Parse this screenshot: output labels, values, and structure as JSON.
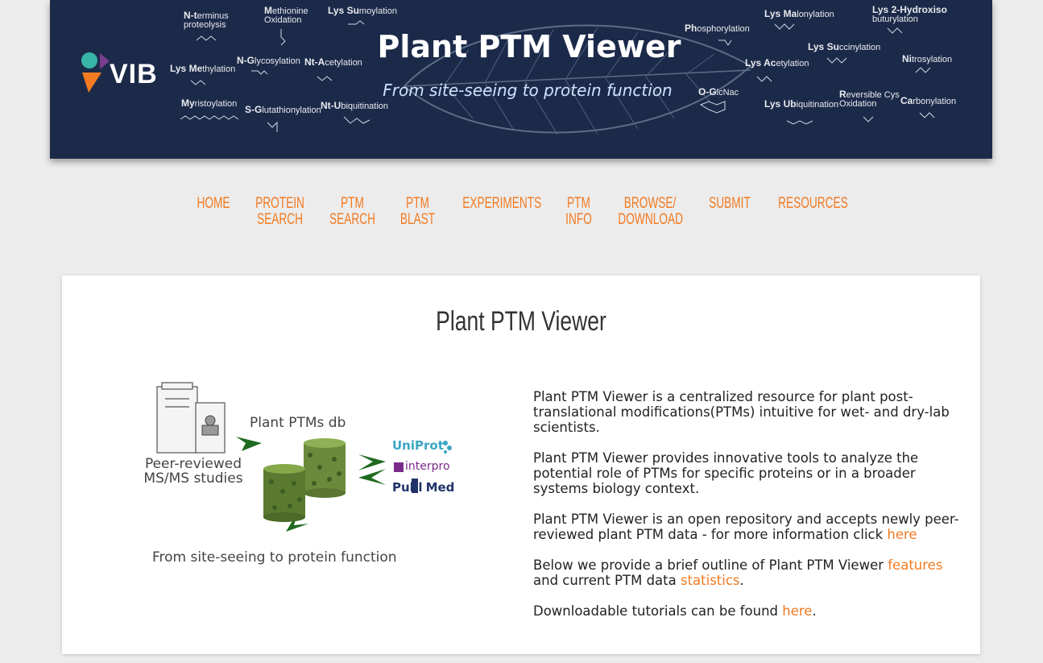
{
  "banner": {
    "title": "Plant PTM Viewer",
    "subtitle": "From site-seeing to protein function",
    "logo_text": "VIB",
    "ptm_labels": [
      {
        "bold": "N-t",
        "rest": "erminus",
        "line2": "proteolysis"
      },
      {
        "bold": "M",
        "rest": "ethionine",
        "line2": "Oxidation"
      },
      {
        "bold": "Lys Su",
        "rest": "moylation",
        "line2": ""
      },
      {
        "bold": "Lys Me",
        "rest": "thylation",
        "line2": ""
      },
      {
        "bold": "N-G",
        "rest": "lycosylation",
        "line2": ""
      },
      {
        "bold": "Nt-A",
        "rest": "cetylation",
        "line2": ""
      },
      {
        "bold": "My",
        "rest": "ristoylation",
        "line2": ""
      },
      {
        "bold": "S-G",
        "rest": "lutathionylation",
        "line2": ""
      },
      {
        "bold": "Nt-U",
        "rest": "biquitination",
        "line2": ""
      },
      {
        "bold": "Lys Ma",
        "rest": "lonylation",
        "line2": ""
      },
      {
        "bold": "Lys 2-Hydroxiso",
        "rest": "",
        "line2": "buturylation"
      },
      {
        "bold": "Ph",
        "rest": "osphorylation",
        "line2": ""
      },
      {
        "bold": "Lys Su",
        "rest": "ccinylation",
        "line2": ""
      },
      {
        "bold": "Lys Ac",
        "rest": "etylation",
        "line2": ""
      },
      {
        "bold": "Ni",
        "rest": "trosylation",
        "line2": ""
      },
      {
        "bold": "O-G",
        "rest": "lcNac",
        "line2": ""
      },
      {
        "bold": "Lys Ub",
        "rest": "iquitination",
        "line2": ""
      },
      {
        "bold": "R",
        "rest": "eversible Cys",
        "line2": "Oxidation"
      },
      {
        "bold": "Ca",
        "rest": "rbonylation",
        "line2": ""
      }
    ]
  },
  "nav": {
    "items": [
      {
        "line1": "HOME",
        "line2": ""
      },
      {
        "line1": "PROTEIN",
        "line2": "SEARCH"
      },
      {
        "line1": "PTM",
        "line2": "SEARCH"
      },
      {
        "line1": "PTM",
        "line2": "BLAST"
      },
      {
        "line1": "EXPERIMENTS",
        "line2": ""
      },
      {
        "line1": "PTM",
        "line2": "INFO"
      },
      {
        "line1": "BROWSE/",
        "line2": "DOWNLOAD"
      },
      {
        "line1": "SUBMIT",
        "line2": ""
      },
      {
        "line1": "RESOURCES",
        "line2": ""
      }
    ]
  },
  "main": {
    "title": "Plant PTM Viewer",
    "figure": {
      "db_label": "Plant PTMs db",
      "studies_label_1": "Peer-reviewed",
      "studies_label_2": "MS/MS studies",
      "caption": "From site-seeing to protein function",
      "uniprot": "UniProt",
      "interpro": "interpro",
      "pubmed_1": "Publ",
      "pubmed_2": "Med"
    },
    "p1": "Plant PTM Viewer is a centralized resource for plant post-translational modifications(PTMs) intuitive for wet- and dry-lab scientists.",
    "p2": "Plant PTM Viewer provides innovative tools to analyze the potential role of PTMs for specific proteins or in a broader systems biology context.",
    "p3": "Plant PTM Viewer is an open repository and accepts newly peer-reviewed plant PTM data - for more information click ",
    "p3_link": "here",
    "p4_a": "Below we provide a brief outline of Plant PTM Viewer ",
    "p4_link1": "features",
    "p4_b": " and current PTM data ",
    "p4_link2": "statistics",
    "p4_c": ".",
    "p5_a": "Downloadable tutorials can be found ",
    "p5_link": "here",
    "p5_b": "."
  },
  "colors": {
    "banner_bg": "#1c2a4a",
    "accent": "#f27a20",
    "page_bg": "#ececec"
  }
}
